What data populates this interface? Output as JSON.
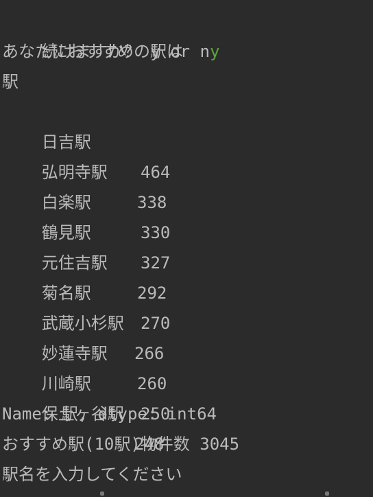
{
  "console": {
    "prompt_text": "続けますか？ y or n",
    "prompt_input": "y",
    "recommend_heading": "あなたにおすすめの駅は",
    "index_label": "駅",
    "stations": [
      {
        "name": "日吉駅",
        "count": "464"
      },
      {
        "name": "弘明寺駅",
        "count": "338"
      },
      {
        "name": "白楽駅",
        "count": "330"
      },
      {
        "name": "鶴見駅",
        "count": "327"
      },
      {
        "name": "元住吉駅",
        "count": "292"
      },
      {
        "name": "菊名駅",
        "count": "270"
      },
      {
        "name": "武蔵小杉駅",
        "count": "266"
      },
      {
        "name": "妙蓮寺駅",
        "count": "260"
      },
      {
        "name": "川崎駅",
        "count": "250"
      },
      {
        "name": "保土ヶ谷駅",
        "count": "248"
      }
    ],
    "series_info": "Name: 駅, dtype: int64",
    "total_text": "おすすめ駅(10駅)物件数 3045",
    "input_prompt": "駅名を入力してください"
  },
  "colors": {
    "background": "#2b2b2b",
    "text": "#bababa",
    "user_input": "#5aa73c"
  }
}
